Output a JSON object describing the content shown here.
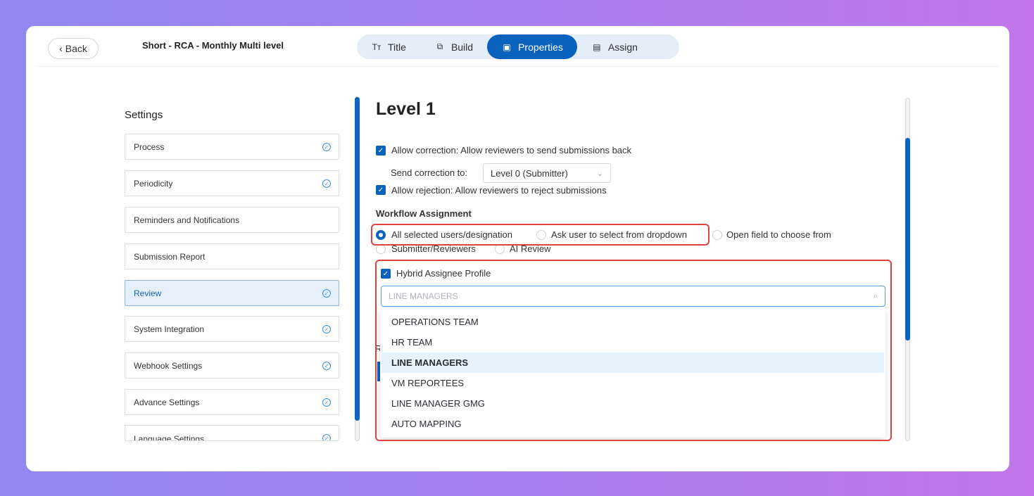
{
  "header": {
    "back_label": "Back",
    "form_title": "Short - RCA - Monthly Multi level",
    "tabs": [
      {
        "label": "Title",
        "icon": "text-icon"
      },
      {
        "label": "Build",
        "icon": "build-icon"
      },
      {
        "label": "Properties",
        "icon": "properties-icon",
        "active": true
      },
      {
        "label": "Assign",
        "icon": "assign-icon"
      }
    ]
  },
  "sidebar": {
    "title": "Settings",
    "items": [
      {
        "label": "Process",
        "checked": true
      },
      {
        "label": "Periodicity",
        "checked": true
      },
      {
        "label": "Reminders and Notifications",
        "checked": false
      },
      {
        "label": "Submission Report",
        "checked": false
      },
      {
        "label": "Review",
        "checked": true,
        "active": true
      },
      {
        "label": "System Integration",
        "checked": true
      },
      {
        "label": "Webhook Settings",
        "checked": true
      },
      {
        "label": "Advance Settings",
        "checked": true
      },
      {
        "label": "Language Settings",
        "checked": true
      }
    ]
  },
  "main": {
    "level_title": "Level 1",
    "allow_correction": "Allow correction: Allow reviewers to send submissions back",
    "send_correction_label": "Send correction to:",
    "send_correction_value": "Level 0 (Submitter)",
    "allow_rejection": "Allow rejection: Allow reviewers to reject submissions",
    "workflow_label": "Workflow Assignment",
    "radios": [
      {
        "label": "All selected users/designation",
        "selected": true
      },
      {
        "label": "Ask user to select from dropdown",
        "selected": false
      },
      {
        "label": "Open field to choose from",
        "selected": false
      },
      {
        "label": "Submitter/Reviewers",
        "selected": false
      },
      {
        "label": "AI Review",
        "selected": false
      }
    ],
    "hybrid_label": "Hybrid Assignee Profile",
    "search_placeholder": "LINE MANAGERS",
    "peek_text": "R",
    "dropdown_options": [
      {
        "label": "OPERATIONS TEAM"
      },
      {
        "label": "HR TEAM"
      },
      {
        "label": "LINE MANAGERS",
        "selected": true
      },
      {
        "label": "VM REPORTEES"
      },
      {
        "label": "LINE MANAGER GMG"
      },
      {
        "label": "AUTO MAPPING"
      }
    ]
  },
  "colors": {
    "accent": "#0a62bc",
    "highlight": "#e0433e"
  }
}
